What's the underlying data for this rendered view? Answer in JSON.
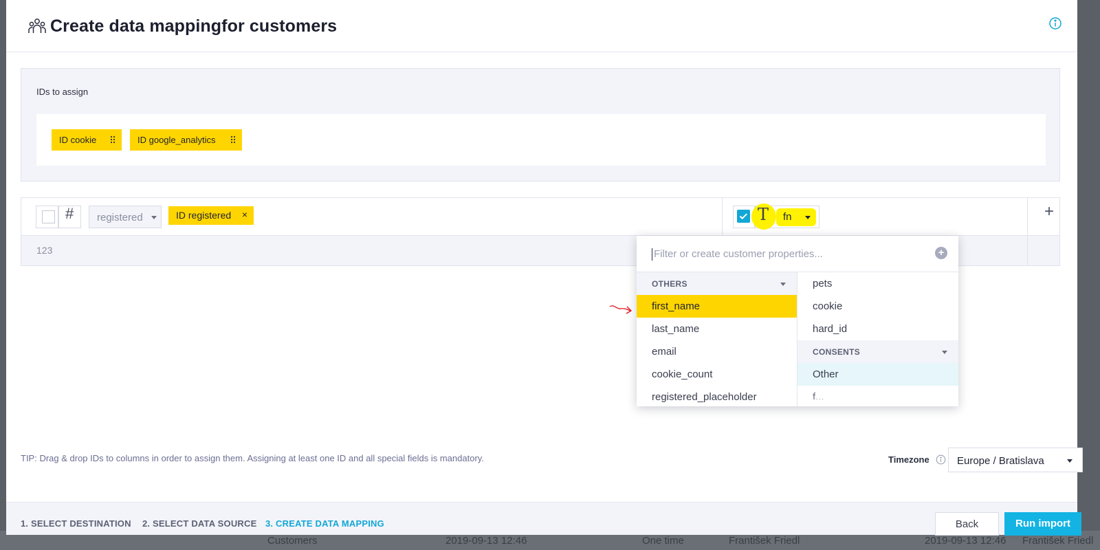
{
  "background": {
    "row_name": "Customers",
    "row_date": "2019-09-13 12:46",
    "row_frequency": "One time",
    "row_user": "František Friedl",
    "row_date_2": "2019-09-13 12:46",
    "row_user_2": "František Friedl"
  },
  "header": {
    "title": "Create data mappingfor customers",
    "icon": "people-icon",
    "info_icon": "info-icon"
  },
  "ids_panel": {
    "label": "IDs to assign",
    "chips": [
      {
        "label": "ID cookie"
      },
      {
        "label": "ID google_analytics"
      }
    ]
  },
  "mapping": {
    "source_type_symbol": "#",
    "source_column": "registered",
    "assigned_id": "ID registered",
    "remove_symbol": "×",
    "sample_value": "123",
    "target_type_symbol": "T",
    "target_property": "fn",
    "add_symbol": "+"
  },
  "dropdown": {
    "placeholder": "Filter or create customer properties...",
    "add_symbol": "+",
    "left_sections": [
      {
        "title": "OTHERS",
        "items": [
          "first_name",
          "last_name",
          "email",
          "cookie_count",
          "registered_placeholder"
        ]
      }
    ],
    "right_items_top": [
      "pets",
      "cookie",
      "hard_id"
    ],
    "right_sections": [
      {
        "title": "CONSENTS",
        "items": [
          "Other",
          "f..."
        ]
      }
    ],
    "highlighted_item": "first_name",
    "colors": {
      "highlight": "#ffd500",
      "hover": "#e6f6fb"
    }
  },
  "tip": "TIP: Drag & drop IDs to columns in order to assign them. Assigning at least one ID and all special fields is mandatory.",
  "timezone": {
    "label": "Timezone",
    "value": "Europe / Bratislava"
  },
  "footer": {
    "steps": [
      {
        "label": "1.  SELECT DESTINATION",
        "active": false
      },
      {
        "label": "2.  SELECT DATA SOURCE",
        "active": false
      },
      {
        "label": "3.  CREATE DATA MAPPING",
        "active": true
      }
    ],
    "back_label": "Back",
    "run_label": "Run import"
  },
  "colors": {
    "accent": "#13a7d6",
    "id_chip": "#ffd500",
    "annotation_highlight": "#fff200",
    "annotation_arrow": "#e0141e"
  }
}
